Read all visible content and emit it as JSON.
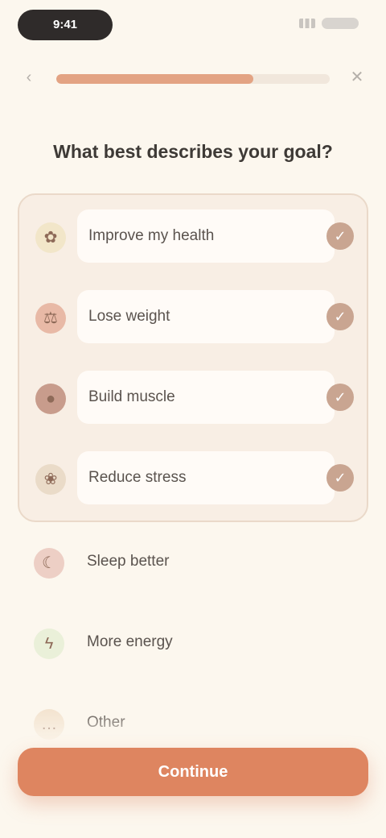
{
  "status_bar": {
    "time": "9:41"
  },
  "nav": {
    "back_icon": "chevron-left-icon",
    "close_icon": "close-icon",
    "progress": 0.72
  },
  "question": "What best describes your goal?",
  "options": [
    {
      "label": "Improve my health",
      "icon": "leaf-icon",
      "glyph": "✿",
      "selected": true,
      "icon_color": "#f2e6c9"
    },
    {
      "label": "Lose weight",
      "icon": "scale-icon",
      "glyph": "⚖",
      "selected": true,
      "icon_color": "#e8b9a6"
    },
    {
      "label": "Build muscle",
      "icon": "dumbbell-icon",
      "glyph": "●",
      "selected": true,
      "icon_color": "#c89c8c"
    },
    {
      "label": "Reduce stress",
      "icon": "lotus-icon",
      "glyph": "❀",
      "selected": true,
      "icon_color": "#eadbc8"
    },
    {
      "label": "Sleep better",
      "icon": "moon-icon",
      "glyph": "☾",
      "selected": false,
      "icon_color": "#edcfc5"
    },
    {
      "label": "More energy",
      "icon": "bolt-icon",
      "glyph": "ϟ",
      "selected": false,
      "icon_color": "#eaf0d9"
    },
    {
      "label": "Other",
      "icon": "dots-icon",
      "glyph": "…",
      "selected": false,
      "icon_color": "#f3e3cf"
    }
  ],
  "check_icon": "check-icon",
  "continue_label": "Continue",
  "colors": {
    "accent": "#de8560",
    "progress": "#e3a383",
    "background": "#fcf7ee"
  }
}
